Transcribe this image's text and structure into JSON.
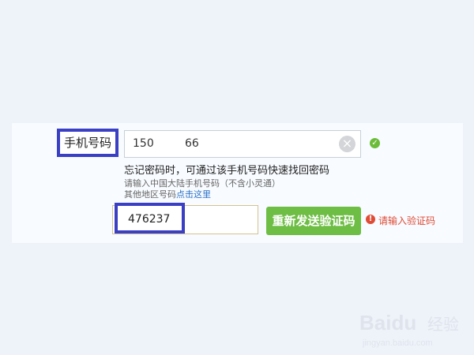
{
  "form": {
    "phone_label": "手机号码",
    "phone_prefix": "150",
    "phone_suffix": "66",
    "clear_symbol": "×",
    "valid_symbol": "✓",
    "hint_main": "忘记密码时，可通过该手机号码快速找回密码",
    "hint_sub": "请输入中国大陆手机号码（不含小灵通）",
    "hint_other_prefix": "其他地区号码",
    "hint_other_link": "点击这里",
    "code_value": "476237",
    "resend_label": "重新发送验证码",
    "error_symbol": "!",
    "error_text": "请输入验证码"
  },
  "watermark": {
    "brand": "Baidu",
    "cn": "经验",
    "url": "jingyan.baidu.com"
  },
  "colors": {
    "highlight": "#3a3fc4",
    "button": "#6ebd45",
    "error": "#e04b35",
    "link": "#2a72c8"
  }
}
